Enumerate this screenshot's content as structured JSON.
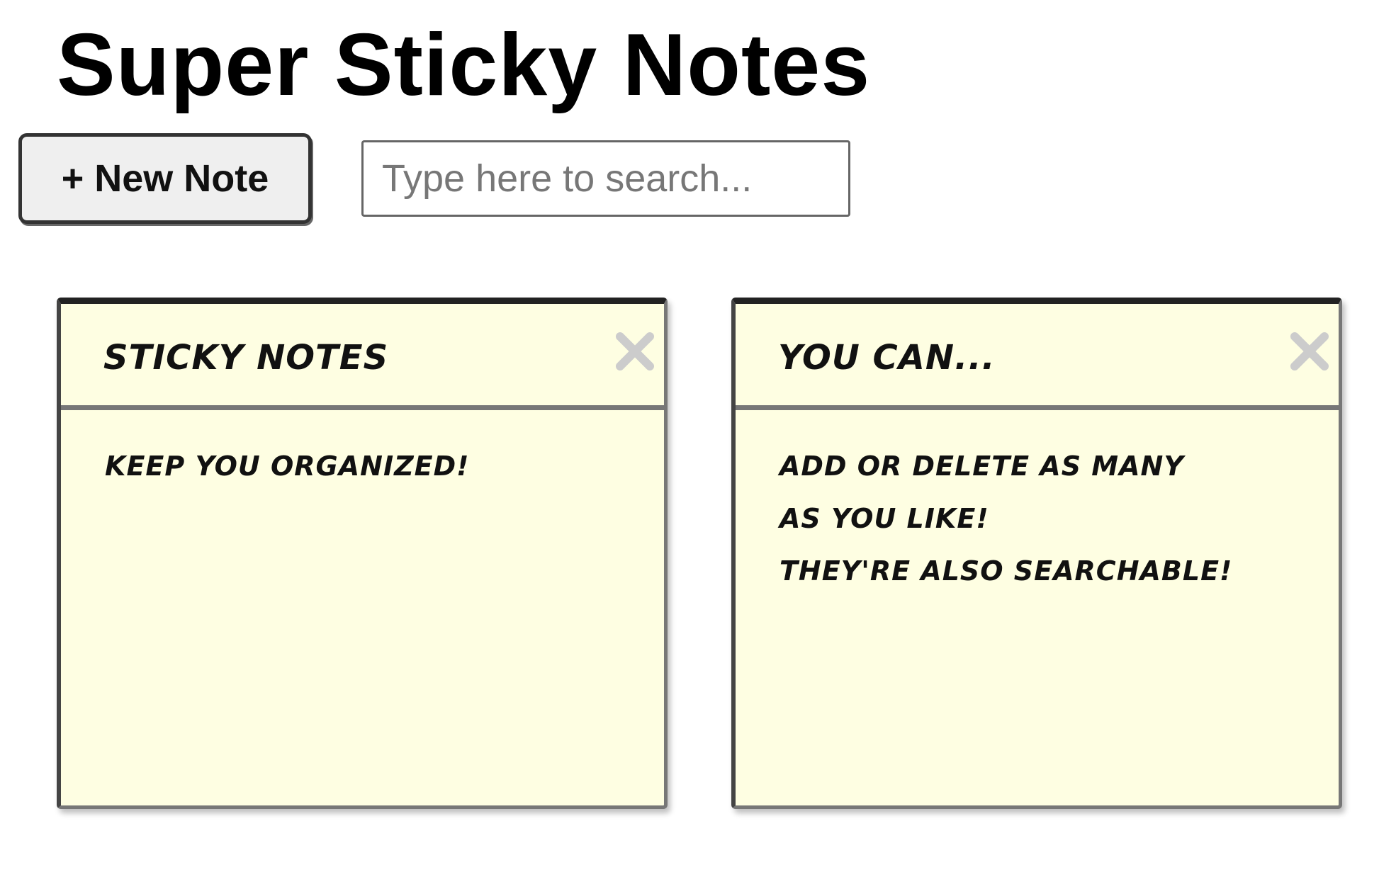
{
  "page": {
    "title": "Super Sticky Notes"
  },
  "toolbar": {
    "new_note_label": "+ New Note",
    "search_placeholder": "Type here to search..."
  },
  "notes": [
    {
      "title": "Sticky notes",
      "body_lines": [
        "Keep you organized!"
      ]
    },
    {
      "title": "You can...",
      "body_lines": [
        "Add or delete as many",
        "as you like!",
        "They're also searchable!"
      ]
    }
  ],
  "icons": {
    "close": "close-icon"
  },
  "colors": {
    "note_background": "#fefee2",
    "close_icon": "#cccccc",
    "button_background": "#efefef"
  }
}
